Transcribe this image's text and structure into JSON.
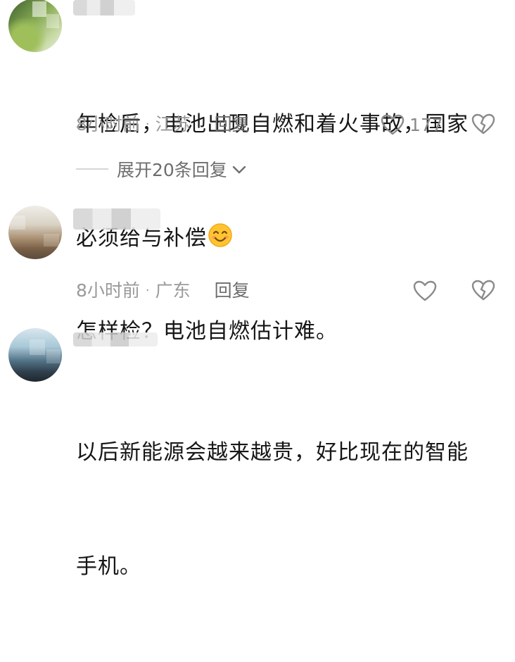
{
  "comments": [
    {
      "text_line1": "年检后，电池出现自燃和着火事故，国家",
      "text_line2": "必须给与补偿",
      "emoji": "smiling-face-emoji",
      "time": "8小时前",
      "location": "江苏",
      "reply_label": "回复",
      "like_count": "177",
      "expand_label": "展开20条回复"
    },
    {
      "text_line1": "怎样检？电池自燃估计难。",
      "time": "8小时前",
      "location": "广东",
      "reply_label": "回复"
    },
    {
      "text_line1": "以后新能源会越来越贵，好比现在的智能",
      "text_line2": "手机。"
    }
  ],
  "separator": "·",
  "icons": {
    "like": "heart-outline-icon",
    "dislike": "broken-heart-icon",
    "expand": "chevron-down-icon"
  },
  "colors": {
    "text": "#161616",
    "meta": "#9a9a9a",
    "reply": "#6d6d6d",
    "icon": "#8a8a8a",
    "background": "#ffffff"
  }
}
